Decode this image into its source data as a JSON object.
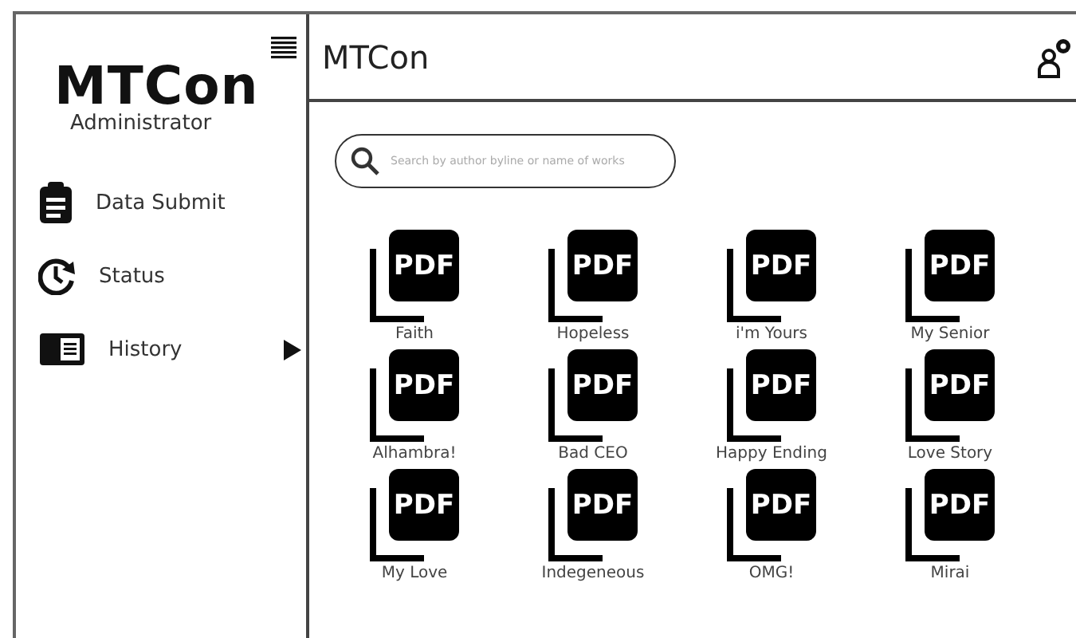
{
  "sidebar": {
    "logo": "MTCon",
    "subtitle": "Administrator",
    "items": [
      {
        "label": "Data Submit",
        "kind": "clipboard",
        "submenu": false
      },
      {
        "label": "Status",
        "kind": "clock",
        "submenu": false
      },
      {
        "label": "History",
        "kind": "book",
        "submenu": true
      }
    ]
  },
  "header": {
    "title": "MTCon"
  },
  "search": {
    "placeholder": "Search by author byline or name of works"
  },
  "files": [
    {
      "name": "Faith",
      "badge": "PDF"
    },
    {
      "name": "Hopeless",
      "badge": "PDF"
    },
    {
      "name": "i'm Yours",
      "badge": "PDF"
    },
    {
      "name": "My Senior",
      "badge": "PDF"
    },
    {
      "name": "Alhambra!",
      "badge": "PDF"
    },
    {
      "name": "Bad CEO",
      "badge": "PDF"
    },
    {
      "name": "Happy Ending",
      "badge": "PDF"
    },
    {
      "name": "Love Story",
      "badge": "PDF"
    },
    {
      "name": "My Love",
      "badge": "PDF"
    },
    {
      "name": "Indegeneous",
      "badge": "PDF"
    },
    {
      "name": "OMG!",
      "badge": "PDF"
    },
    {
      "name": "Mirai",
      "badge": "PDF"
    }
  ]
}
